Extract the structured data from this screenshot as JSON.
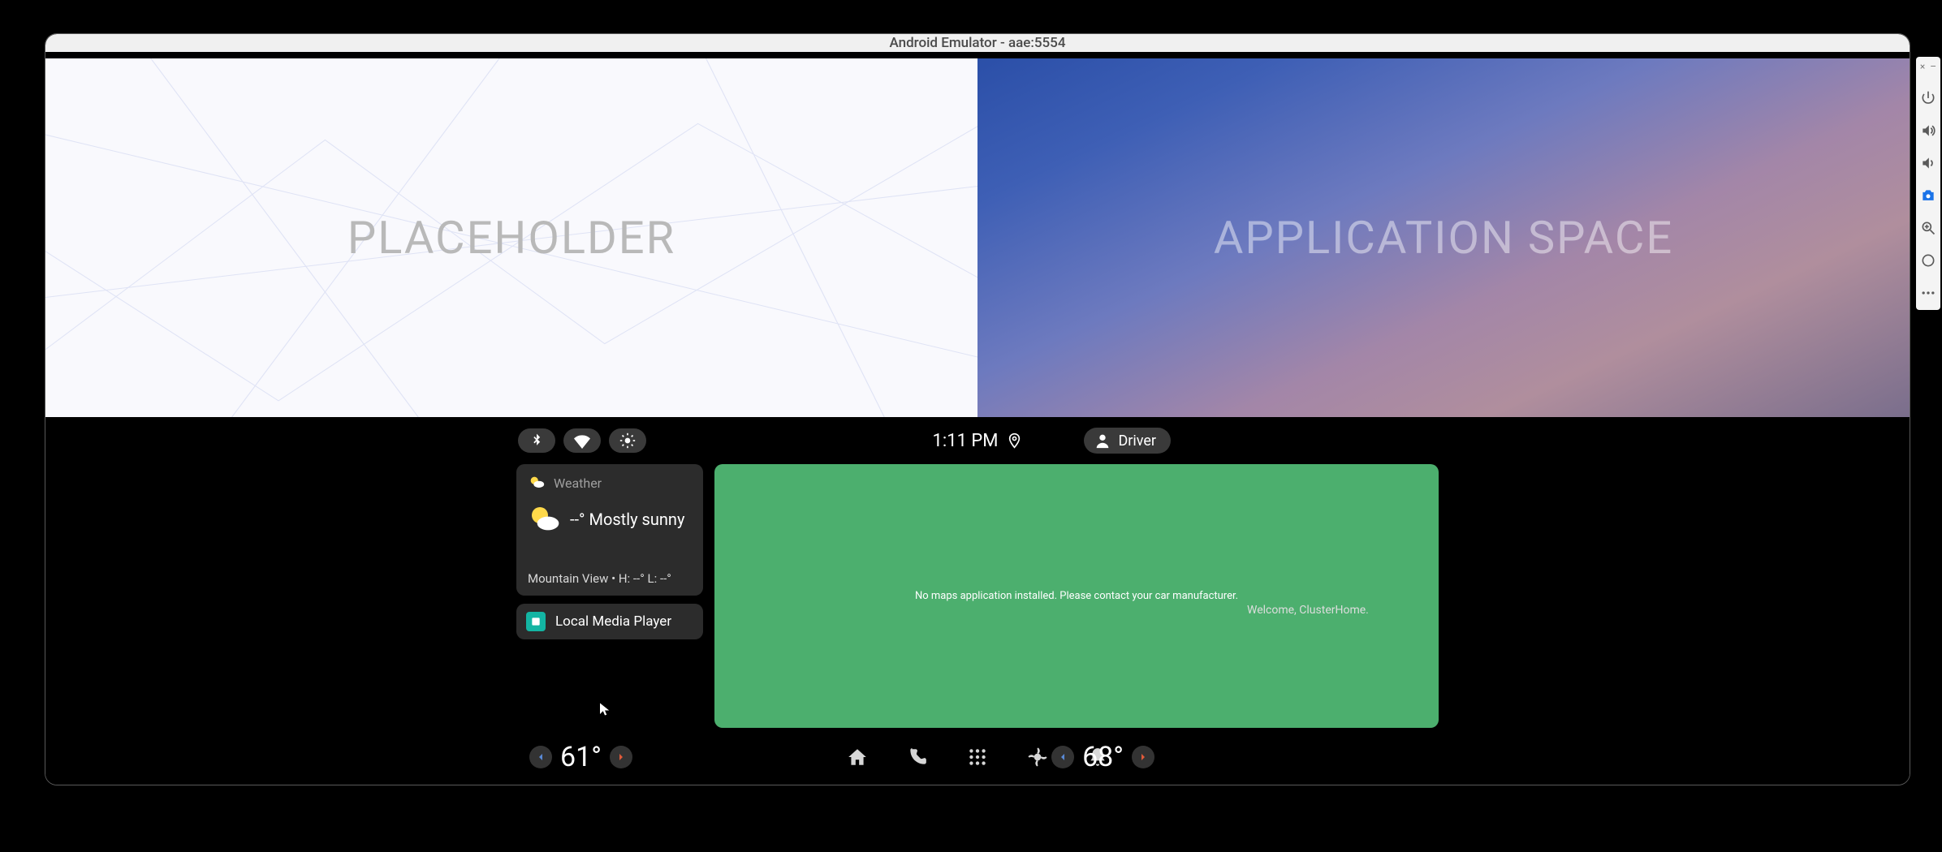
{
  "emulator": {
    "title": "Android Emulator - aae:5554"
  },
  "top_panels": {
    "left_label": "PLACEHOLDER",
    "right_label": "APPLICATION SPACE"
  },
  "statusbar": {
    "time": "1:11 PM",
    "user_label": "Driver"
  },
  "weather_card": {
    "header": "Weather",
    "main_text": "--° Mostly sunny",
    "sub_text": "Mountain View • H: --° L: --°"
  },
  "media_card": {
    "label": "Local Media Player"
  },
  "map_card": {
    "message": "No maps application installed. Please contact your car manufacturer."
  },
  "welcome_text": "Welcome, ClusterHome.",
  "climate": {
    "left_temp": "61°",
    "right_temp": "68°"
  },
  "side_toolbar": {
    "icons": [
      "power",
      "volume-up",
      "volume-down",
      "camera",
      "zoom",
      "circle",
      "more"
    ]
  }
}
